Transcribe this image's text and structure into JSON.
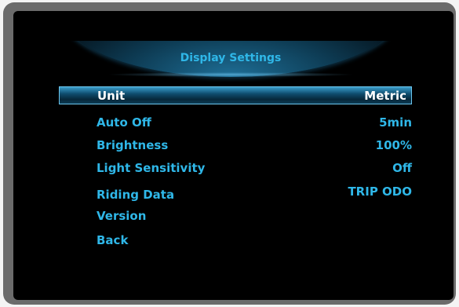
{
  "header": {
    "title": "Display Settings"
  },
  "menu": {
    "items": [
      {
        "label": "Unit",
        "value": "Metric",
        "selected": true
      },
      {
        "label": "Auto Off",
        "value": "5min"
      },
      {
        "label": "Brightness",
        "value": "100%"
      },
      {
        "label": "Light Sensitivity",
        "value": "Off"
      },
      {
        "label": "Riding Data",
        "value": "TRIP ODO"
      },
      {
        "label": "Version",
        "value": ""
      },
      {
        "label": "Back",
        "value": ""
      }
    ]
  },
  "colors": {
    "accent": "#2fb7e8",
    "selected_text": "#ffffff",
    "screen_background": "#000000",
    "bezel": "#6b6b6b"
  }
}
